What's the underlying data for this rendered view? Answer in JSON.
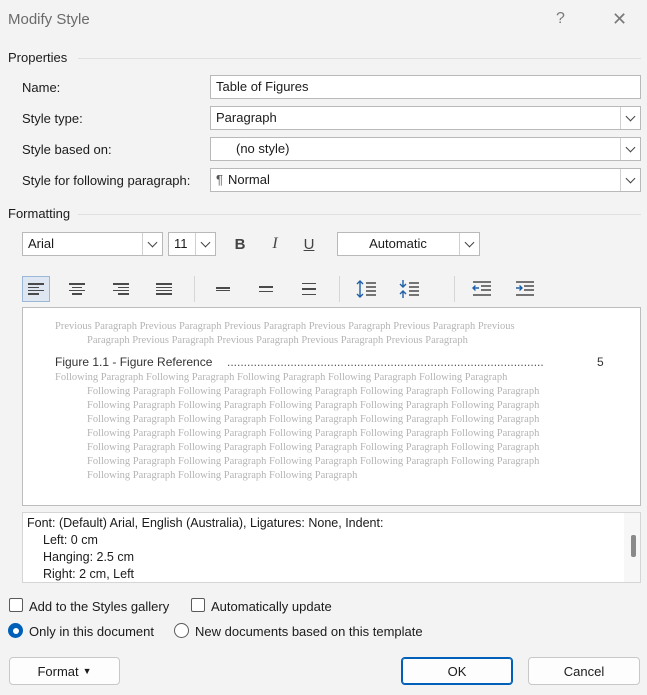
{
  "window": {
    "title": "Modify Style",
    "help": "?",
    "close": "✕"
  },
  "properties": {
    "heading": "Properties",
    "name_label": "Name:",
    "name_value": "Table of Figures",
    "style_type_label": "Style type:",
    "style_type_value": "Paragraph",
    "based_on_label": "Style based on:",
    "based_on_value": "(no style)",
    "following_label": "Style for following paragraph:",
    "following_glyph": "¶",
    "following_value": "Normal"
  },
  "formatting": {
    "heading": "Formatting",
    "font": "Arial",
    "size": "11",
    "bold": "B",
    "italic": "I",
    "underline": "U",
    "color": "Automatic"
  },
  "preview": {
    "previous_1": "Previous Paragraph Previous Paragraph Previous Paragraph Previous Paragraph Previous Paragraph Previous",
    "previous_2": "Paragraph Previous Paragraph Previous Paragraph Previous Paragraph Previous Paragraph",
    "sample_text": "Figure 1.1 - Figure Reference",
    "sample_leader": "...............................................................................................",
    "sample_page": "5",
    "following_1": "Following Paragraph Following Paragraph Following Paragraph Following Paragraph Following Paragraph",
    "following_full": "Following Paragraph Following Paragraph Following Paragraph Following Paragraph Following Paragraph",
    "following_last": "Following Paragraph Following Paragraph Following Paragraph"
  },
  "description": {
    "line1": "Font: (Default) Arial, English (Australia), Ligatures: None, Indent:",
    "line2": "Left:  0 cm",
    "line3": "Hanging:  2.5 cm",
    "line4": "Right:  2 cm, Left"
  },
  "options": {
    "add_gallery": "Add to the Styles gallery",
    "auto_update": "Automatically update",
    "only_document": "Only in this document",
    "new_documents": "New documents based on this template"
  },
  "buttons": {
    "format": "Format",
    "ok": "OK",
    "cancel": "Cancel"
  },
  "colors": {
    "accent": "#005fb8",
    "background": "#f3f3f3"
  }
}
